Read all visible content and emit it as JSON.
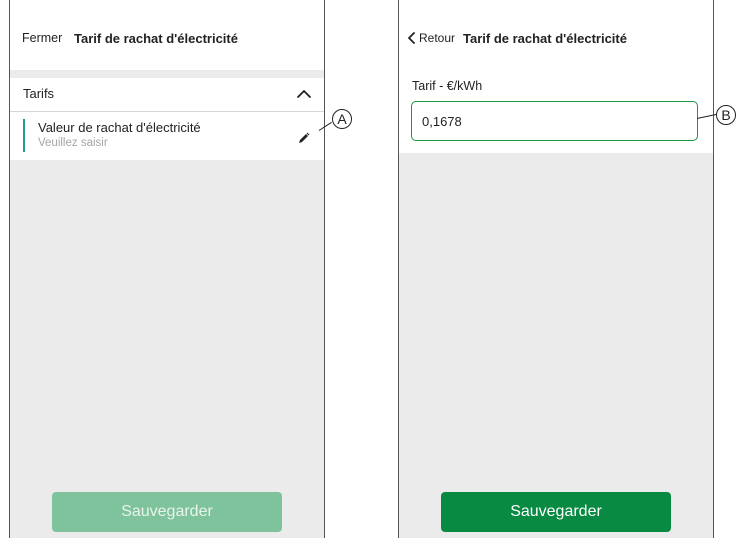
{
  "screen_a": {
    "header": {
      "close_label": "Fermer",
      "title": "Tarif de rachat d'électricité"
    },
    "section": {
      "label": "Tarifs",
      "state": "expanded",
      "toggle_icon": "chevron-up-icon"
    },
    "item": {
      "title": "Valeur de rachat d'électricité",
      "placeholder": "Veuillez saisir",
      "edit_icon": "pencil-icon"
    },
    "save_button": {
      "label": "Sauvegarder",
      "state": "disabled"
    }
  },
  "screen_b": {
    "header": {
      "back_label": "Retour",
      "back_icon": "chevron-left-icon",
      "title": "Tarif de rachat d'électricité"
    },
    "field": {
      "label": "Tarif - €/kWh",
      "value": "0,1678"
    },
    "save_button": {
      "label": "Sauvegarder",
      "state": "enabled"
    }
  },
  "callouts": {
    "a": "A",
    "b": "B"
  },
  "colors": {
    "accent_green": "#098a42",
    "disabled_green": "#7ec39b",
    "teal_indicator": "#1f9e8e",
    "input_border": "#1a9640",
    "screen_background": "#ebebeb"
  }
}
